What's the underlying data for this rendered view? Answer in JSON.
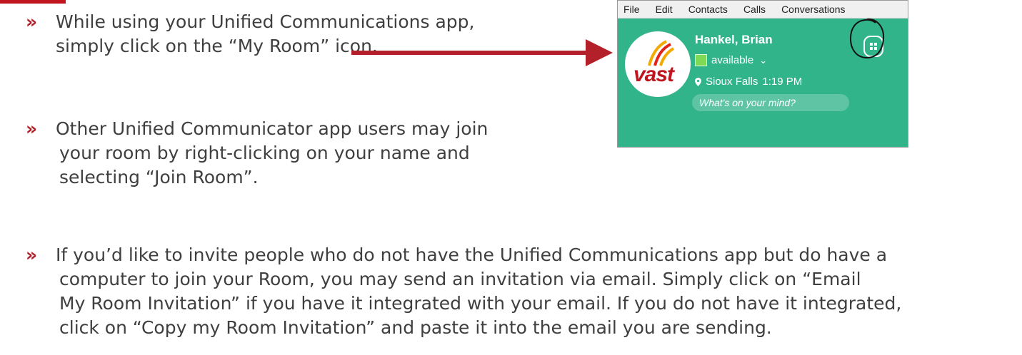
{
  "bullets": {
    "marker": "»",
    "b1": [
      "While using your Unified Communications app,",
      "simply click on the “My Room” icon."
    ],
    "b2": [
      "Other Unified Communicator app users may join",
      "your room by right-clicking on your name and",
      "selecting “Join Room”."
    ],
    "b3": [
      "If you’d like to invite people who do not have the Unified Communications app but do have a",
      "computer to join your Room, you may send an invitation via email. Simply click on “Email",
      "My Room Invitation” if you have it integrated with your email.  If you do not have it integrated,",
      "click on “Copy my Room Invitation” and paste it into the email you are sending."
    ]
  },
  "app": {
    "menu": [
      "File",
      "Edit",
      "Contacts",
      "Calls",
      "Conversations"
    ],
    "logo_text": "vast",
    "user_name": "Hankel, Brian",
    "status": "available",
    "location": "Sioux Falls",
    "time": "1:19 PM",
    "mood_placeholder": "What's on your mind?"
  },
  "colors": {
    "accent_red": "#b3202a",
    "panel_green": "#32b48b",
    "text": "#3f3f3f"
  },
  "icons": {
    "status_chevron": "chevron-down-icon",
    "location_pin": "location-pin-icon",
    "my_room": "my-room-icon"
  }
}
